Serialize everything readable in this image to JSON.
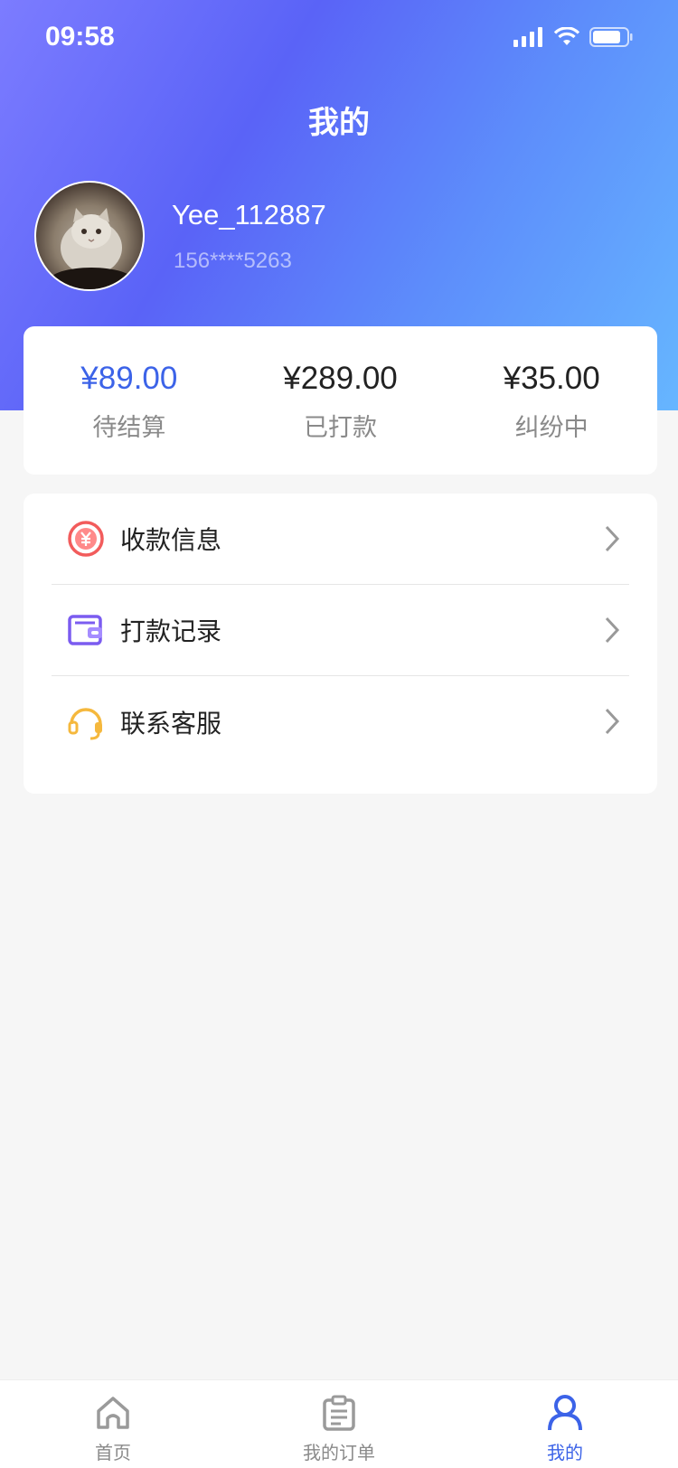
{
  "status_bar": {
    "time": "09:58"
  },
  "header": {
    "title": "我的"
  },
  "profile": {
    "username": "Yee_112887",
    "phone": "156****5263"
  },
  "stats": [
    {
      "value": "¥89.00",
      "label": "待结算",
      "highlight": true
    },
    {
      "value": "¥289.00",
      "label": "已打款",
      "highlight": false
    },
    {
      "value": "¥35.00",
      "label": "纠纷中",
      "highlight": false
    }
  ],
  "menu": [
    {
      "label": "收款信息",
      "icon": "yen-icon",
      "color": "#f25c5c"
    },
    {
      "label": "打款记录",
      "icon": "wallet-icon",
      "color": "#7b5cf0"
    },
    {
      "label": "联系客服",
      "icon": "headset-icon",
      "color": "#f5b83d"
    }
  ],
  "tabbar": [
    {
      "label": "首页",
      "icon": "home-icon",
      "active": false
    },
    {
      "label": "我的订单",
      "icon": "orders-icon",
      "active": false
    },
    {
      "label": "我的",
      "icon": "user-icon",
      "active": true
    }
  ],
  "colors": {
    "accent": "#3c63e8",
    "background": "#f6f6f6"
  }
}
